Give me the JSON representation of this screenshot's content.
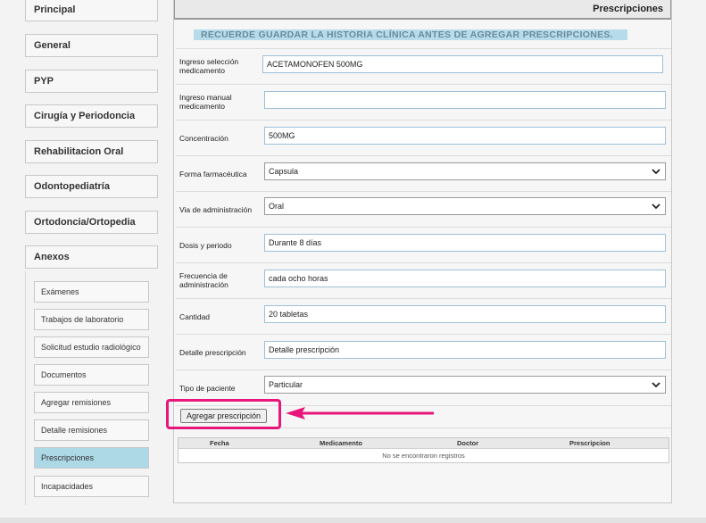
{
  "sidebar": {
    "items": [
      {
        "label": "Principal"
      },
      {
        "label": "General"
      },
      {
        "label": "PYP"
      },
      {
        "label": "Cirugía y Periodoncia"
      },
      {
        "label": "Rehabilitacion Oral"
      },
      {
        "label": "Odontopediatría"
      },
      {
        "label": "Ortodoncia/Ortopedia"
      },
      {
        "label": "Anexos"
      }
    ],
    "subitems": [
      {
        "label": "Exámenes"
      },
      {
        "label": "Trabajos de laboratorio"
      },
      {
        "label": "Solicitud estudio radiológico"
      },
      {
        "label": "Documentos"
      },
      {
        "label": "Agregar remisiones"
      },
      {
        "label": "Detalle remisiones"
      },
      {
        "label": "Prescripciones",
        "active": true
      },
      {
        "label": "Incapacidades"
      }
    ]
  },
  "panel": {
    "title": "Prescripciones",
    "notice": "RECUERDE GUARDAR LA HISTORIA CLÍNICA ANTES DE AGREGAR PRESCRIPCIONES."
  },
  "form": {
    "seleccion_label": "Ingreso selección medicamento",
    "seleccion_value": "ACETAMONOFEN 500MG",
    "manual_label": "Ingreso manual medicamento",
    "manual_value": "",
    "concentracion_label": "Concentración",
    "concentracion_value": "500MG",
    "forma_label": "Forma farmacéutica",
    "forma_value": "Capsula",
    "via_label": "Via de administración",
    "via_value": "Oral",
    "dosis_label": "Dosis y periodo",
    "dosis_value": "Durante 8 días",
    "frecuencia_label": "Frecuencia de administración",
    "frecuencia_value": "cada ocho horas",
    "cantidad_label": "Cantidad",
    "cantidad_value": "20 tabletas",
    "detalle_label": "Detalle prescripción",
    "detalle_value": "Detalle prescripción",
    "tipo_label": "Tipo de paciente",
    "tipo_value": "Particular",
    "add_button": "Agregar prescripción"
  },
  "table": {
    "columns": [
      "Fecha",
      "Medicamento",
      "Doctor",
      "Prescripcion"
    ],
    "empty_message": "No se encontraron registros"
  },
  "colors": {
    "highlight": "#e8167a",
    "notice_bg": "#b6dcec",
    "active_item": "#add8e6"
  }
}
